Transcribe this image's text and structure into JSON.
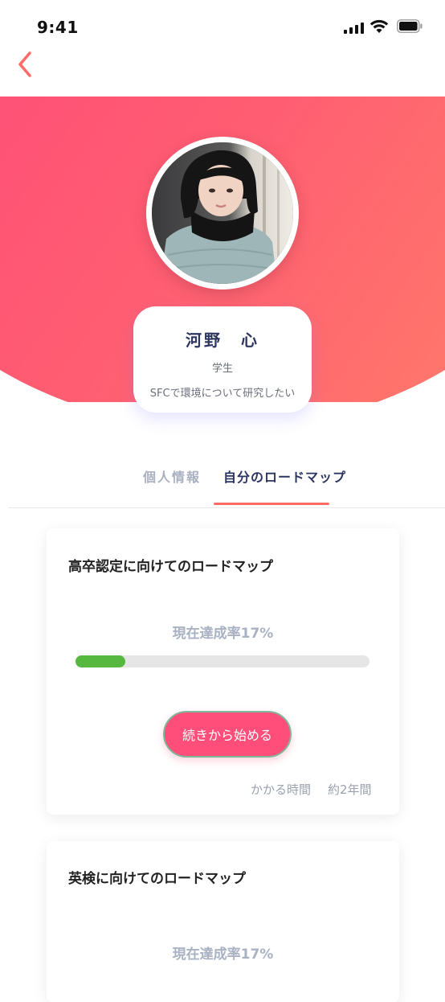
{
  "status_bar": {
    "time": "9:41"
  },
  "profile": {
    "name": "河野　心",
    "role": "学生",
    "description": "SFCで環境について研究したい"
  },
  "tabs": [
    {
      "label": "個人情報",
      "active": false
    },
    {
      "label": "自分のロードマップ",
      "active": true
    }
  ],
  "roadmaps": [
    {
      "title": "高卒認定に向けてのロードマップ",
      "progress_label": "現在達成率17%",
      "progress": 0.17,
      "button_label": "続きから始める",
      "time_label": "かかる時間",
      "time_value": "約2年間"
    },
    {
      "title": "英検に向けてのロードマップ",
      "progress_label": "現在達成率17%"
    }
  ],
  "colors": {
    "accent": "#ff4e79",
    "gradient_start": "#ff3f7b",
    "gradient_end": "#ff8367",
    "progress": "#56b83f",
    "name_text": "#2c3560",
    "tab_indicator": "#ff6b66"
  },
  "icons": {
    "back": "chevron-left-icon",
    "signal": "signal-icon",
    "wifi": "wifi-icon",
    "battery": "battery-icon"
  }
}
